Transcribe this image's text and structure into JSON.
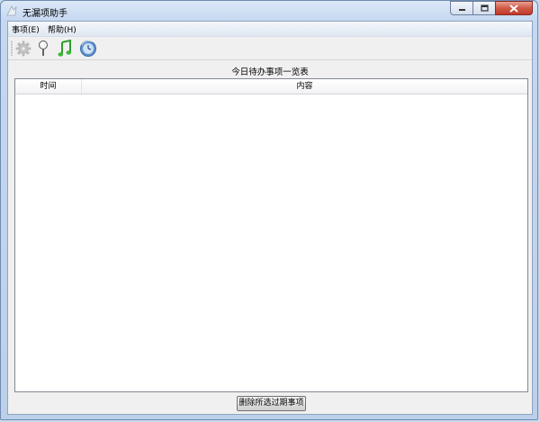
{
  "window": {
    "title": "无漏项助手",
    "icon": "app-icon",
    "controls": [
      "minimize-icon",
      "maximize-icon",
      "close-icon"
    ]
  },
  "menubar": {
    "items": [
      {
        "label": "事项(E)"
      },
      {
        "label": "帮助(H)"
      }
    ]
  },
  "toolbar": {
    "buttons": [
      {
        "icon": "gear-icon"
      },
      {
        "icon": "pin-icon"
      },
      {
        "icon": "music-note-icon"
      },
      {
        "icon": "globe-clock-icon"
      }
    ]
  },
  "main": {
    "list_title": "今日待办事项一览表",
    "columns": [
      {
        "label": "时间"
      },
      {
        "label": "内容"
      }
    ],
    "rows": []
  },
  "footer": {
    "delete_button_label": "删除所选过期事项"
  },
  "colors": {
    "titlebar": "#c5d8f0",
    "close_button": "#c0392b",
    "client_background": "#f0f0f0",
    "list_background": "#ffffff"
  }
}
